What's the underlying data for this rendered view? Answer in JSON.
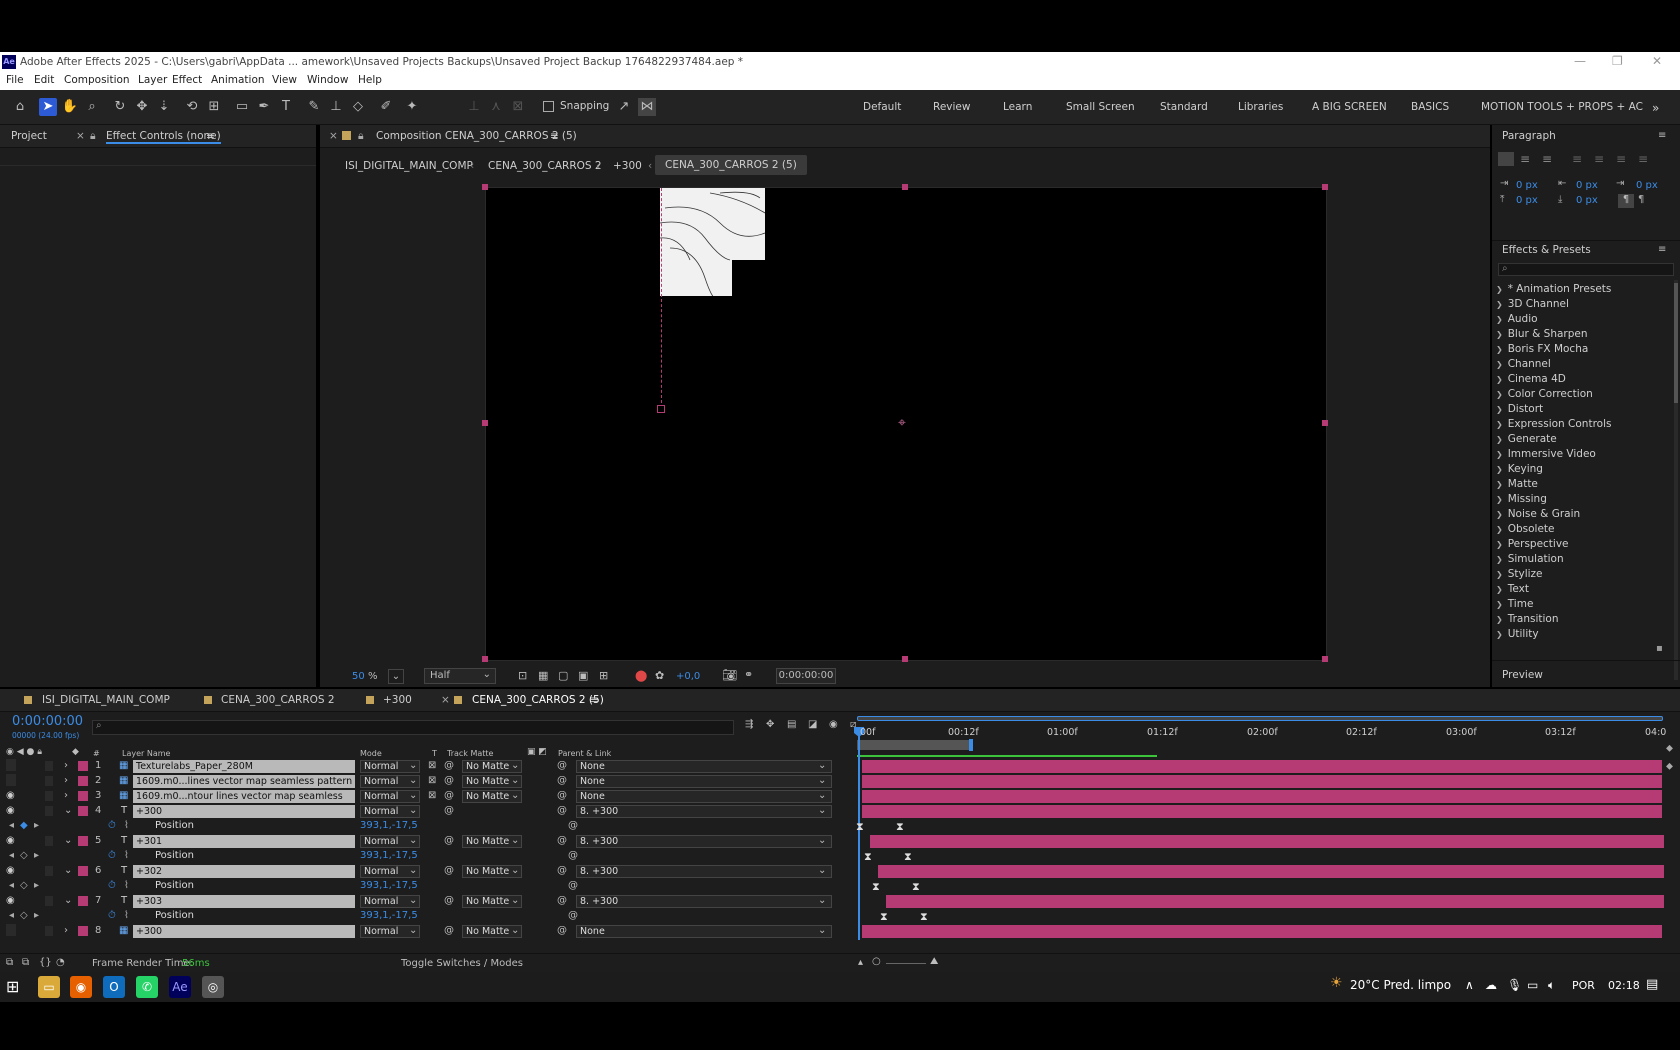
{
  "window": {
    "title": "Adobe After Effects 2025 - C:\\Users\\gabri\\AppData ... amework\\Unsaved Projects Backups\\Unsaved Project Backup 1764822937484.aep *",
    "app_badge": "Ae"
  },
  "menu": [
    "File",
    "Edit",
    "Composition",
    "Layer",
    "Effect",
    "Animation",
    "View",
    "Window",
    "Help"
  ],
  "toolbar": {
    "snapping": "Snapping"
  },
  "workspaces": [
    "Default",
    "Review",
    "Learn",
    "Small Screen",
    "Standard",
    "Libraries",
    "A BIG SCREEN",
    "BASICS",
    "MOTION TOOLS + PROPS + AC"
  ],
  "left_panel": {
    "tab_project": "Project",
    "tab_effect_controls": "Effect Controls (none)"
  },
  "comp_panel": {
    "tab": "Composition CENA_300_CARROS 2 (5)",
    "breadcrumbs": [
      "ISI_DIGITAL_MAIN_COMP",
      "CENA_300_CARROS 2",
      "+300",
      "CENA_300_CARROS 2 (5)"
    ],
    "zoom": "50",
    "zoom_unit": "%",
    "resolution": "Half",
    "exposure": "+0,0",
    "timecode": "0:00:00:00"
  },
  "paragraph": {
    "title": "Paragraph",
    "values": [
      "0 px",
      "0 px",
      "0 px",
      "0 px",
      "0 px"
    ]
  },
  "effects": {
    "title": "Effects & Presets",
    "search_placeholder": "",
    "items": [
      "* Animation Presets",
      "3D Channel",
      "Audio",
      "Blur & Sharpen",
      "Boris FX Mocha",
      "Channel",
      "Cinema 4D",
      "Color Correction",
      "Distort",
      "Expression Controls",
      "Generate",
      "Immersive Video",
      "Keying",
      "Matte",
      "Missing",
      "Noise & Grain",
      "Obsolete",
      "Perspective",
      "Simulation",
      "Stylize",
      "Text",
      "Time",
      "Transition",
      "Utility"
    ]
  },
  "preview": {
    "title": "Preview"
  },
  "timeline": {
    "tabs": [
      "ISI_DIGITAL_MAIN_COMP",
      "CENA_300_CARROS 2",
      "+300",
      "CENA_300_CARROS 2 (5)"
    ],
    "timecode": "0:00:00:00",
    "fps": "00000 (24.00 fps)",
    "col_headers": {
      "layer_name": "Layer Name",
      "mode": "Mode",
      "t": "T",
      "track_matte": "Track Matte",
      "parent": "Parent & Link",
      "num": "#"
    },
    "ruler": [
      "00f",
      "00:12f",
      "01:00f",
      "01:12f",
      "02:00f",
      "02:12f",
      "03:00f",
      "03:12f",
      "04:0"
    ],
    "layers": [
      {
        "num": "1",
        "name": "Texturelabs_Paper_280M",
        "mode": "Normal",
        "matte": "No Matte",
        "parent": "None"
      },
      {
        "num": "2",
        "name": "1609.m0...lines vector map seamless pattern copiar",
        "mode": "Normal",
        "matte": "No Matte",
        "parent": "None"
      },
      {
        "num": "3",
        "name": "1609.m0...ntour lines vector map seamless pattern",
        "mode": "Normal",
        "matte": "No Matte",
        "parent": "None"
      },
      {
        "num": "4",
        "name": "+300",
        "mode": "Normal",
        "matte": "",
        "parent": "8. +300",
        "prop": "Position",
        "value": "393,1,-17,5"
      },
      {
        "num": "5",
        "name": "+301",
        "mode": "Normal",
        "matte": "No Matte",
        "parent": "8. +300",
        "prop": "Position",
        "value": "393,1,-17,5"
      },
      {
        "num": "6",
        "name": "+302",
        "mode": "Normal",
        "matte": "No Matte",
        "parent": "8. +300",
        "prop": "Position",
        "value": "393,1,-17,5"
      },
      {
        "num": "7",
        "name": "+303",
        "mode": "Normal",
        "matte": "No Matte",
        "parent": "8. +300",
        "prop": "Position",
        "value": "393,1,-17,5"
      },
      {
        "num": "8",
        "name": "+300",
        "mode": "Normal",
        "matte": "No Matte",
        "parent": "None"
      }
    ],
    "footer": {
      "render_label": "Frame Render Time:",
      "render_value": "56ms",
      "toggle": "Toggle Switches / Modes"
    }
  },
  "taskbar": {
    "weather": "20°C  Pred. limpo",
    "lang": "POR",
    "time": "02:18"
  },
  "colors": {
    "accent": "#2d5bd6",
    "label_pink": "#b63a74",
    "timecode_blue": "#3b8ce6"
  }
}
